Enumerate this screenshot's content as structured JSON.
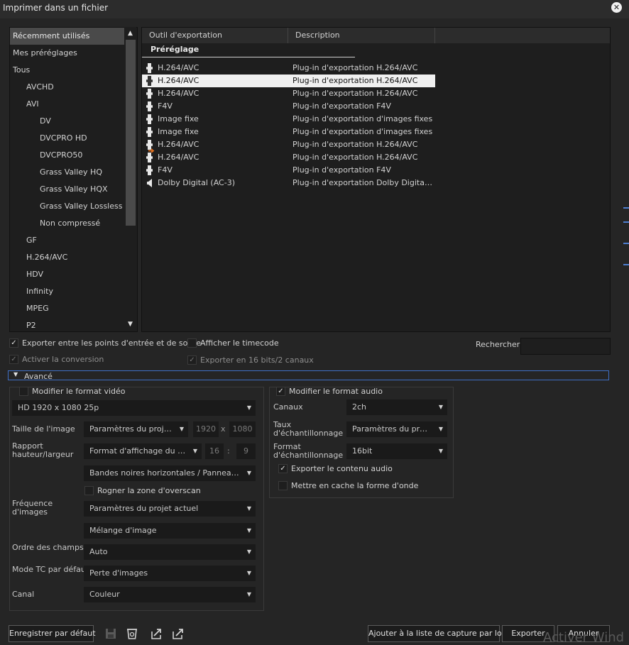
{
  "window": {
    "title": "Imprimer dans un fichier"
  },
  "tree": {
    "items": [
      {
        "label": "Récemment utilisés"
      },
      {
        "label": "Mes préréglages"
      },
      {
        "label": "Tous"
      },
      {
        "label": "AVCHD"
      },
      {
        "label": "AVI"
      },
      {
        "label": "DV"
      },
      {
        "label": "DVCPRO HD"
      },
      {
        "label": "DVCPRO50"
      },
      {
        "label": "Grass Valley HQ"
      },
      {
        "label": "Grass Valley HQX"
      },
      {
        "label": "Grass Valley Lossless"
      },
      {
        "label": "Non compressé"
      },
      {
        "label": "GF"
      },
      {
        "label": "H.264/AVC"
      },
      {
        "label": "HDV"
      },
      {
        "label": "Infinity"
      },
      {
        "label": "MPEG"
      },
      {
        "label": "P2"
      }
    ],
    "scroll_up": "▲",
    "scroll_down": "▼"
  },
  "table": {
    "col_tool": "Outil d'exportation",
    "col_desc": "Description",
    "group": "Préréglage",
    "rows": [
      {
        "tool": "H.264/AVC",
        "desc": "Plug-in d'exportation H.264/AVC",
        "icon": "film-icon"
      },
      {
        "tool": "H.264/AVC",
        "desc": "Plug-in d'exportation H.264/AVC",
        "icon": "film-icon"
      },
      {
        "tool": "H.264/AVC",
        "desc": "Plug-in d'exportation H.264/AVC",
        "icon": "film-icon"
      },
      {
        "tool": "F4V",
        "desc": "Plug-in d'exportation F4V",
        "icon": "film-icon"
      },
      {
        "tool": "Image fixe",
        "desc": "Plug-in d'exportation d'images fixes",
        "icon": "film-icon"
      },
      {
        "tool": "Image fixe",
        "desc": "Plug-in d'exportation d'images fixes",
        "icon": "film-icon"
      },
      {
        "tool": "H.264/AVC",
        "desc": "Plug-in d'exportation H.264/AVC",
        "icon": "film-export-icon"
      },
      {
        "tool": "H.264/AVC",
        "desc": "Plug-in d'exportation H.264/AVC",
        "icon": "film-icon"
      },
      {
        "tool": "F4V",
        "desc": "Plug-in d'exportation F4V",
        "icon": "film-icon"
      },
      {
        "tool": "Dolby Digital (AC-3)",
        "desc": "Plug-in d'exportation Dolby Digital (AC-3)",
        "icon": "speaker-icon"
      }
    ]
  },
  "options": {
    "export_range": "Exporter entre les points d'entrée et de sortie",
    "show_timecode": "Afficher le timecode",
    "enable_conversion": "Activer la conversion",
    "export_16bit": "Exporter en 16 bits/2 canaux",
    "search_label": "Rechercher",
    "search_value": "",
    "check": "✓"
  },
  "advanced": {
    "label": "Avancé",
    "toggle": "▼"
  },
  "video": {
    "modify_label": "Modifier le format vidéo",
    "format": "HD 1920 x 1080 25p",
    "size_label": "Taille de l'image",
    "size_value": "Paramètres du projet actuel",
    "width": "1920",
    "times": "x",
    "height": "1080",
    "aspect_label": "Rapport hauteur/largeur",
    "aspect_value": "Format d'affichage du projet actuel",
    "aspect_w": "16",
    "colon": ":",
    "aspect_h": "9",
    "letterbox_value": "Bandes noires horizontales / Panneau latéral",
    "overscan_label": "Rogner la zone d'overscan",
    "framerate_label": "Fréquence d'images",
    "framerate_value": "Paramètres du projet actuel",
    "blend_value": "Mélange d'image",
    "field_order_label": "Ordre des champs",
    "field_order_value": "Auto",
    "tc_mode_label": "Mode TC par défaut",
    "tc_mode_value": "Perte d'images",
    "channel_label": "Canal",
    "channel_value": "Couleur"
  },
  "audio": {
    "modify_label": "Modifier le format audio",
    "channels_label": "Canaux",
    "channels_value": "2ch",
    "rate_label": "Taux d'échantillonnage",
    "rate_value": "Paramètres du projet actuel",
    "format_label": "Format d'échantillonnage",
    "format_value": "16bit",
    "export_audio_label": "Exporter le contenu audio",
    "cache_label": "Mettre en cache la forme d'onde"
  },
  "footer": {
    "save_default": "Enregistrer par défaut",
    "batch": "Ajouter à la liste de capture par lots",
    "export": "Exporter",
    "cancel": "Annuler",
    "watermark": "Activer Wind"
  },
  "colors": {
    "accent": "#3f6fc4",
    "background": "#252525",
    "selection": "#f0f0f0"
  }
}
